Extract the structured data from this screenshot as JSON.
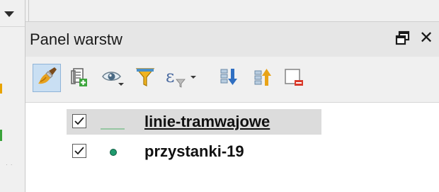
{
  "panel": {
    "title": "Panel warstw"
  },
  "toolbar": {
    "tools": [
      {
        "icon": "style-brush-icon",
        "active": true
      },
      {
        "icon": "add-group-icon"
      },
      {
        "icon": "visibility-eye-icon"
      },
      {
        "icon": "filter-legend-icon"
      },
      {
        "icon": "filter-expression-icon"
      },
      {
        "icon": "expand-all-icon"
      },
      {
        "icon": "collapse-all-icon"
      },
      {
        "icon": "remove-layer-icon"
      }
    ]
  },
  "layers": [
    {
      "name": "linie-tramwajowe",
      "checked": true,
      "symbol": "line",
      "symbol_color": "#7fbf8f",
      "selected": true,
      "underlined": true
    },
    {
      "name": "przystanki-19",
      "checked": true,
      "symbol": "point",
      "symbol_color": "#1f9a6e",
      "selected": false,
      "underlined": false
    }
  ],
  "colors": {
    "accent_active_tool": "#c9dff3",
    "title_bar": "#e6e6e6",
    "selected_row": "#dcdcdc"
  }
}
